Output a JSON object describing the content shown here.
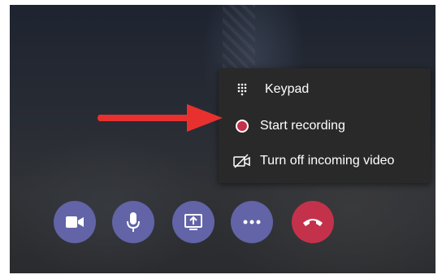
{
  "menu": {
    "items": [
      {
        "label": "Keypad",
        "icon": "keypad-icon"
      },
      {
        "label": "Start recording",
        "icon": "record-icon"
      },
      {
        "label": "Turn off incoming video",
        "icon": "video-off-icon"
      }
    ]
  },
  "toolbar": {
    "buttons": [
      {
        "icon": "video-camera-icon"
      },
      {
        "icon": "microphone-icon"
      },
      {
        "icon": "share-screen-icon"
      },
      {
        "icon": "more-options-icon"
      },
      {
        "icon": "hang-up-icon"
      }
    ]
  },
  "annotation": {
    "icon": "arrow-icon",
    "color": "#e8312f"
  },
  "colors": {
    "accent": "#6264a7",
    "hangup": "#c4314b",
    "menu_bg": "#292929",
    "arrow": "#e8312f"
  }
}
